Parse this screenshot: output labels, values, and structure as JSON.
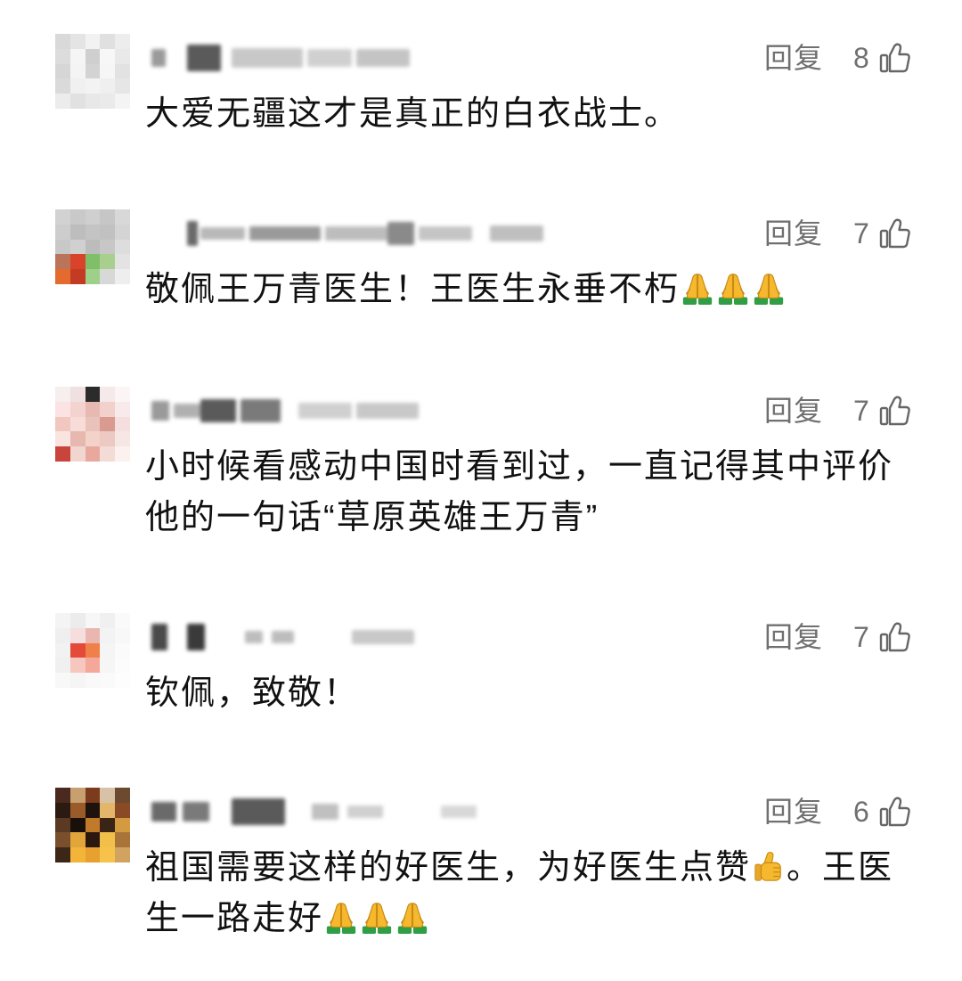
{
  "colors": {
    "background": "#ffffff",
    "comment_text": "#111111",
    "meta_text": "#707070",
    "emoji_skin": "#f5b82e",
    "emoji_sleeve": "#2f9e44"
  },
  "like_icon": "thumbs-up-outline",
  "comments": [
    {
      "reply_label": "回复",
      "likes": "8",
      "lines": [
        [
          {
            "text": "大爱无疆这才是真正的白衣战士。"
          }
        ]
      ]
    },
    {
      "reply_label": "回复",
      "likes": "7",
      "lines": [
        [
          {
            "text": "敬佩王万青医生！王医生永垂不朽"
          },
          {
            "icon": "folded-hands-emoji"
          },
          {
            "icon": "folded-hands-emoji"
          },
          {
            "icon": "folded-hands-emoji"
          }
        ]
      ]
    },
    {
      "reply_label": "回复",
      "likes": "7",
      "lines": [
        [
          {
            "text": "小时候看感动中国时看到过，一直记得其中评价"
          }
        ],
        [
          {
            "text": "他的一句话“草原英雄王万青”"
          }
        ]
      ]
    },
    {
      "reply_label": "回复",
      "likes": "7",
      "lines": [
        [
          {
            "text": "钦佩，致敬！"
          }
        ]
      ]
    },
    {
      "reply_label": "回复",
      "likes": "6",
      "lines": [
        [
          {
            "text": "祖国需要这样的好医生，为好医生点赞"
          },
          {
            "icon": "thumbs-up-emoji"
          },
          {
            "text": "。王医"
          }
        ],
        [
          {
            "text": "生一路走好"
          },
          {
            "icon": "folded-hands-emoji"
          },
          {
            "icon": "folded-hands-emoji"
          },
          {
            "icon": "folded-hands-emoji"
          }
        ]
      ]
    }
  ]
}
